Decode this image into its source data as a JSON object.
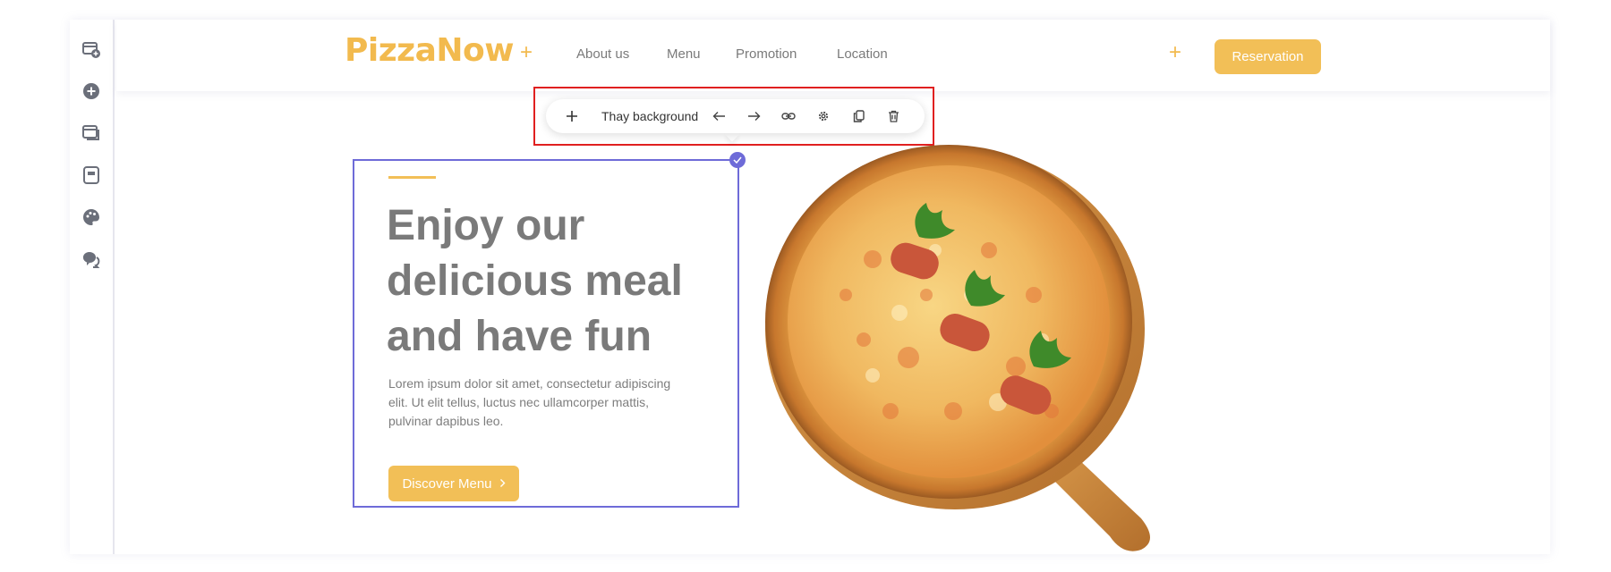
{
  "leftbar": {
    "icons": [
      "add-section-icon",
      "add-element-icon",
      "pages-icon",
      "layout-icon",
      "palette-icon",
      "comments-icon"
    ]
  },
  "header": {
    "logo": "PizzaNow",
    "nav": [
      "About us",
      "Menu",
      "Promotion",
      "Location"
    ],
    "cta": "Reservation"
  },
  "toolbar": {
    "label": "Thay background",
    "icons": [
      "plus-icon",
      "arrow-left-icon",
      "arrow-right-icon",
      "link-icon",
      "settings-icon",
      "duplicate-icon",
      "trash-icon"
    ]
  },
  "hero": {
    "headline_lines": [
      "Enjoy our",
      "delicious meal",
      "and have fun"
    ],
    "paragraph_lines": [
      "Lorem ipsum dolor sit amet, consectetur adipiscing",
      "elit. Ut elit tellus, luctus nec ullamcorper mattis,",
      "pulvinar dapibus leo."
    ],
    "button": "Discover Menu"
  },
  "colors": {
    "accent": "#f2bf57",
    "selection": "#6e6bd8",
    "highlight": "#e02020",
    "text": "#7a7a7a"
  }
}
